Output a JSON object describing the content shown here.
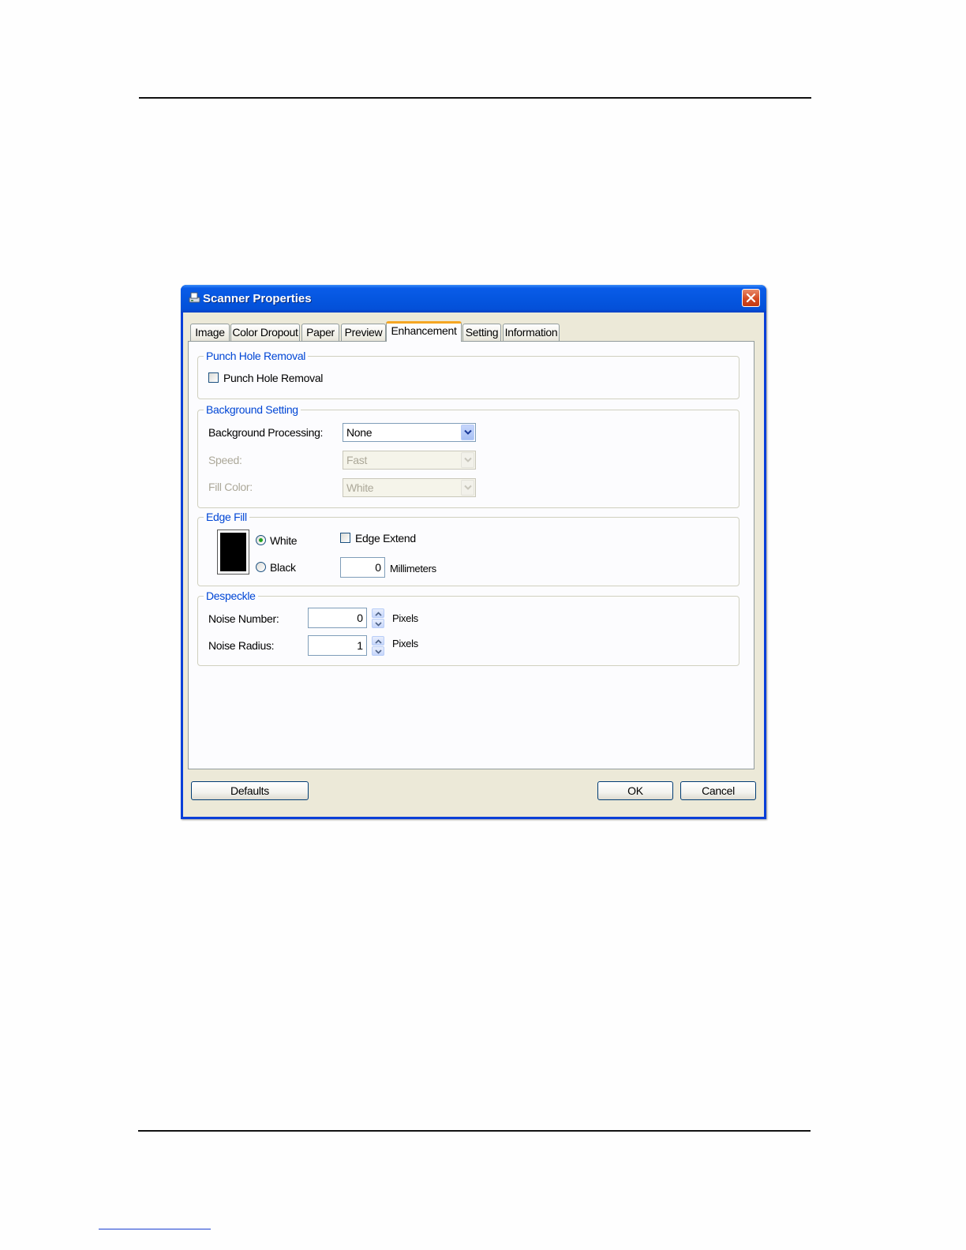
{
  "window": {
    "title": "Scanner Properties"
  },
  "tabs": [
    {
      "label": "Image"
    },
    {
      "label": "Color Dropout"
    },
    {
      "label": "Paper"
    },
    {
      "label": "Preview"
    },
    {
      "label": "Enhancement",
      "active": true
    },
    {
      "label": "Setting"
    },
    {
      "label": "Information"
    }
  ],
  "punch_hole": {
    "group_label": "Punch Hole Removal",
    "checkbox_label": "Punch Hole Removal",
    "checked": false
  },
  "background": {
    "group_label": "Background Setting",
    "processing_label": "Background Processing:",
    "processing_value": "None",
    "speed_label": "Speed:",
    "speed_value": "Fast",
    "fill_label": "Fill Color:",
    "fill_value": "White"
  },
  "edge_fill": {
    "group_label": "Edge Fill",
    "white_label": "White",
    "black_label": "Black",
    "selected": "White",
    "extend_label": "Edge Extend",
    "extend_checked": false,
    "extend_value": "0",
    "unit": "Millimeters"
  },
  "despeckle": {
    "group_label": "Despeckle",
    "noise_number_label": "Noise Number:",
    "noise_number_value": "0",
    "noise_radius_label": "Noise Radius:",
    "noise_radius_value": "1",
    "unit": "Pixels"
  },
  "buttons": {
    "defaults": "Defaults",
    "ok": "OK",
    "cancel": "Cancel"
  },
  "colors": {
    "titlebar": "#0556e0",
    "group_label": "#0046d5",
    "active_tab_accent": "#f5a623",
    "close_button": "#d44a22"
  }
}
